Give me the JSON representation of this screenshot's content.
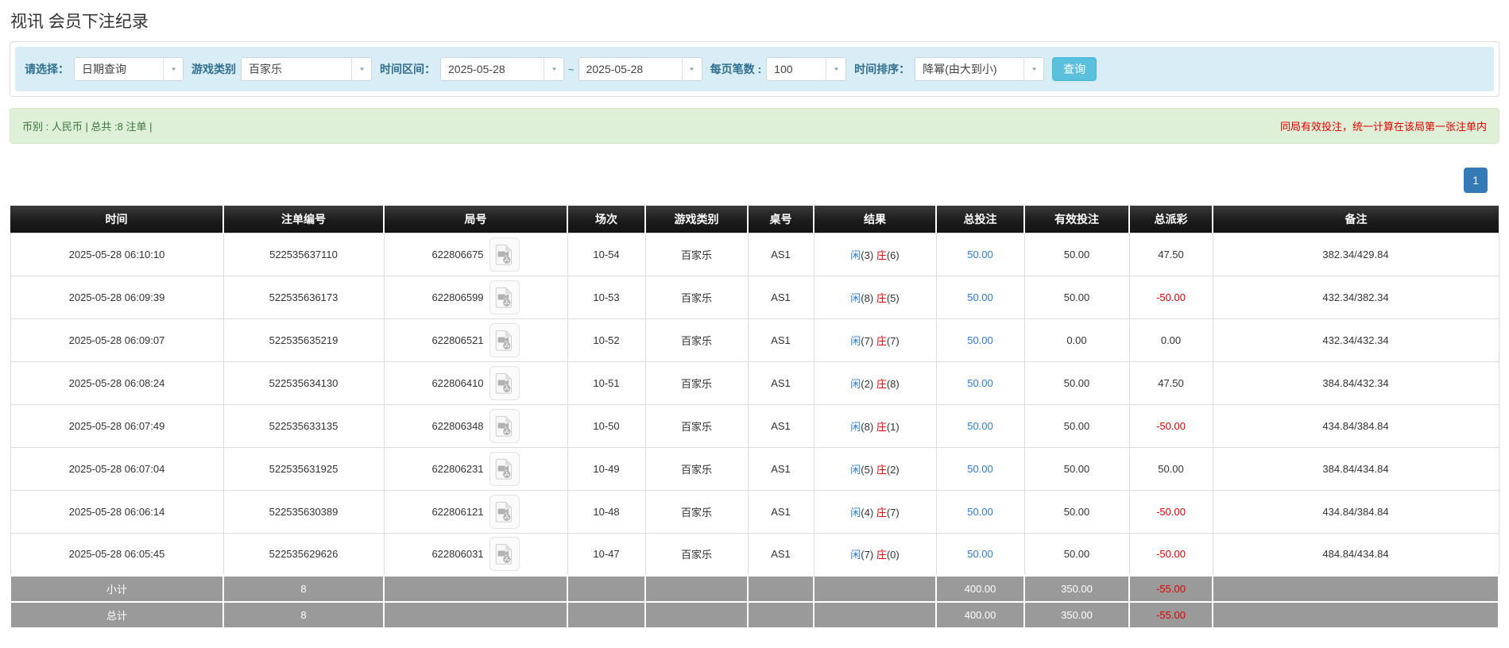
{
  "title": "视讯 会员下注纪录",
  "filters": {
    "select_label": "请选择：",
    "select_value": "日期查询",
    "game_type_label": "游戏类别",
    "game_type_value": "百家乐",
    "time_range_label": "时间区间：",
    "date_from": "2025-05-28",
    "tilde": "~",
    "date_to": "2025-05-28",
    "page_size_label": "每页笔数 :",
    "page_size_value": "100",
    "sort_label": "时间排序：",
    "sort_value": "降幂(由大到小)",
    "search_button": "查询"
  },
  "summary": {
    "left": "币别 : 人民币 | 总共 :8 注单 |",
    "right": "同局有效投注，统一计算在该局第一张注单内"
  },
  "pagination": {
    "current": "1"
  },
  "colors": {
    "accent_blue": "#2b7bd9",
    "negative_red": "#e40000",
    "header_black": "#1c1c1c",
    "footer_gray": "#9a9a9a",
    "search_cyan": "#5bc0de",
    "pager_blue": "#337ab7"
  },
  "icons": {
    "video_replay": "video-replay-document-icon",
    "chevron": "chevron-down-icon"
  },
  "table": {
    "headers": [
      "时间",
      "注单编号",
      "局号",
      "场次",
      "游戏类别",
      "桌号",
      "结果",
      "总投注",
      "有效投注",
      "总派彩",
      "备注"
    ],
    "rows": [
      {
        "time": "2025-05-28 06:10:10",
        "bet_id": "522535637110",
        "round_id": "622806675",
        "session": "10-54",
        "game": "百家乐",
        "table_id": "AS1",
        "p_char": "闲",
        "p_num": "(3)",
        "b_char": "庄",
        "b_num": "(6)",
        "total_bet": "50.00",
        "valid_bet": "50.00",
        "payout": "47.50",
        "remark": "382.34/429.84"
      },
      {
        "time": "2025-05-28 06:09:39",
        "bet_id": "522535636173",
        "round_id": "622806599",
        "session": "10-53",
        "game": "百家乐",
        "table_id": "AS1",
        "p_char": "闲",
        "p_num": "(8)",
        "b_char": "庄",
        "b_num": "(5)",
        "total_bet": "50.00",
        "valid_bet": "50.00",
        "payout": "-50.00",
        "remark": "432.34/382.34"
      },
      {
        "time": "2025-05-28 06:09:07",
        "bet_id": "522535635219",
        "round_id": "622806521",
        "session": "10-52",
        "game": "百家乐",
        "table_id": "AS1",
        "p_char": "闲",
        "p_num": "(7)",
        "b_char": "庄",
        "b_num": "(7)",
        "total_bet": "50.00",
        "valid_bet": "0.00",
        "payout": "0.00",
        "remark": "432.34/432.34"
      },
      {
        "time": "2025-05-28 06:08:24",
        "bet_id": "522535634130",
        "round_id": "622806410",
        "session": "10-51",
        "game": "百家乐",
        "table_id": "AS1",
        "p_char": "闲",
        "p_num": "(2)",
        "b_char": "庄",
        "b_num": "(8)",
        "total_bet": "50.00",
        "valid_bet": "50.00",
        "payout": "47.50",
        "remark": "384.84/432.34"
      },
      {
        "time": "2025-05-28 06:07:49",
        "bet_id": "522535633135",
        "round_id": "622806348",
        "session": "10-50",
        "game": "百家乐",
        "table_id": "AS1",
        "p_char": "闲",
        "p_num": "(8)",
        "b_char": "庄",
        "b_num": "(1)",
        "total_bet": "50.00",
        "valid_bet": "50.00",
        "payout": "-50.00",
        "remark": "434.84/384.84"
      },
      {
        "time": "2025-05-28 06:07:04",
        "bet_id": "522535631925",
        "round_id": "622806231",
        "session": "10-49",
        "game": "百家乐",
        "table_id": "AS1",
        "p_char": "闲",
        "p_num": "(5)",
        "b_char": "庄",
        "b_num": "(2)",
        "total_bet": "50.00",
        "valid_bet": "50.00",
        "payout": "50.00",
        "remark": "384.84/434.84"
      },
      {
        "time": "2025-05-28 06:06:14",
        "bet_id": "522535630389",
        "round_id": "622806121",
        "session": "10-48",
        "game": "百家乐",
        "table_id": "AS1",
        "p_char": "闲",
        "p_num": "(4)",
        "b_char": "庄",
        "b_num": "(7)",
        "total_bet": "50.00",
        "valid_bet": "50.00",
        "payout": "-50.00",
        "remark": "434.84/384.84"
      },
      {
        "time": "2025-05-28 06:05:45",
        "bet_id": "522535629626",
        "round_id": "622806031",
        "session": "10-47",
        "game": "百家乐",
        "table_id": "AS1",
        "p_char": "闲",
        "p_num": "(7)",
        "b_char": "庄",
        "b_num": "(0)",
        "total_bet": "50.00",
        "valid_bet": "50.00",
        "payout": "-50.00",
        "remark": "484.84/434.84"
      }
    ],
    "subtotal": {
      "label": "小计",
      "count": "8",
      "total_bet": "400.00",
      "valid_bet": "350.00",
      "payout": "-55.00"
    },
    "total": {
      "label": "总计",
      "count": "8",
      "total_bet": "400.00",
      "valid_bet": "350.00",
      "payout": "-55.00"
    }
  }
}
